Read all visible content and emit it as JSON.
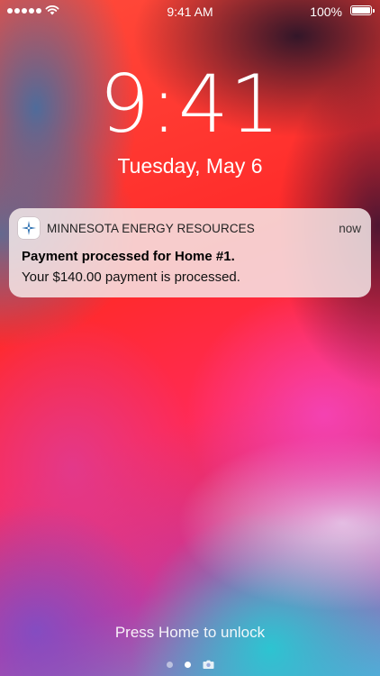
{
  "status_bar": {
    "time": "9:41 AM",
    "battery_percent": "100%",
    "signal_bars": 5,
    "battery_level": 1.0
  },
  "lock_screen": {
    "clock": "9:41",
    "date": "Tuesday, May 6",
    "unlock_hint": "Press Home to unlock"
  },
  "notification": {
    "app_name": "MINNESOTA ENERGY RESOURCES",
    "time": "now",
    "title": "Payment processed for Home #1.",
    "body": "Your $140.00 payment is processed.",
    "icon": "energy-star-icon",
    "accent_color": "#2b6fb0"
  },
  "page_indicator": {
    "pages": [
      "dot",
      "dot",
      "camera-icon"
    ],
    "active_index": 1
  }
}
